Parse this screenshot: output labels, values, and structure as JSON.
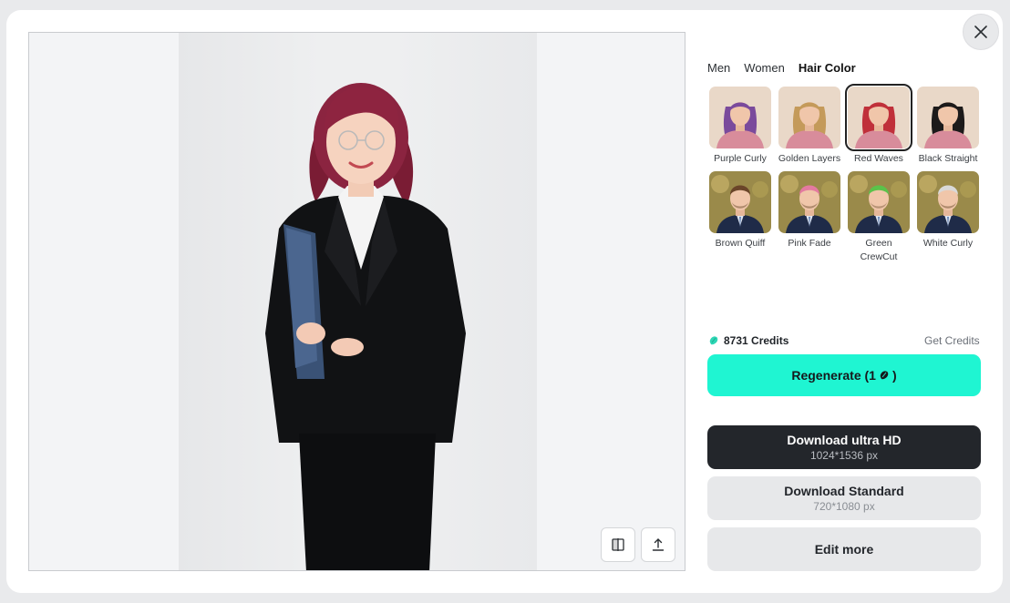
{
  "dialog": {
    "close_label": "Close"
  },
  "tabs": [
    {
      "label": "Men",
      "active": false
    },
    {
      "label": "Women",
      "active": false
    },
    {
      "label": "Hair Color",
      "active": true
    }
  ],
  "styles": [
    {
      "label": "Purple Curly",
      "hair_color": "#7a4a9c",
      "selected": false
    },
    {
      "label": "Golden Layers",
      "hair_color": "#c49a5a",
      "selected": false
    },
    {
      "label": "Red Waves",
      "hair_color": "#c0303a",
      "selected": true
    },
    {
      "label": "Black Straight",
      "hair_color": "#1c1a1a",
      "selected": false
    },
    {
      "label": "Brown Quiff",
      "hair_color": "#6a4529",
      "selected": false
    },
    {
      "label": "Pink Fade",
      "hair_color": "#e47aa0",
      "selected": false
    },
    {
      "label": "Green CrewCut",
      "hair_color": "#5bc24a",
      "selected": false
    },
    {
      "label": "White Curly",
      "hair_color": "#d9d9d9",
      "selected": false
    }
  ],
  "credits": {
    "amount_text": "8731 Credits",
    "get_label": "Get Credits",
    "icon": "gem-icon"
  },
  "actions": {
    "regenerate_label": "Regenerate (1",
    "regenerate_close": ")",
    "hd_title": "Download ultra HD",
    "hd_size": "1024*1536 px",
    "std_title": "Download Standard",
    "std_size": "720*1080 px",
    "edit_label": "Edit more"
  },
  "preview": {
    "tools": [
      "compare-icon",
      "share-upload-icon"
    ]
  },
  "colors": {
    "accent": "#1ff5d2",
    "dark_button": "#23262b",
    "light_button": "#e7e8ea",
    "credit_gem": "#2ed6b5"
  }
}
